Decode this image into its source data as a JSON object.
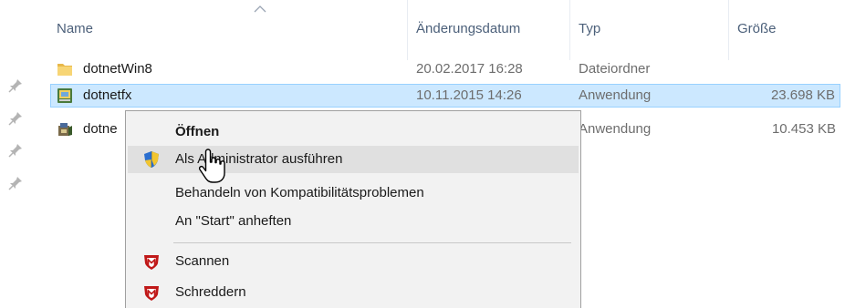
{
  "columns": {
    "name": "Name",
    "date": "Änderungsdatum",
    "type": "Typ",
    "size": "Größe"
  },
  "files": [
    {
      "name": "dotnetWin8",
      "date": "20.02.2017 16:28",
      "type": "Dateiordner",
      "size": "",
      "icon": "folder-icon"
    },
    {
      "name": "dotnetfx",
      "date": "10.11.2015 14:26",
      "type": "Anwendung",
      "size": "23.698 KB",
      "icon": "installer-icon",
      "selected": true
    },
    {
      "name": "dotne",
      "date": "",
      "type": "Anwendung",
      "size": "10.453 KB",
      "icon": "setup-icon"
    }
  ],
  "context_menu": {
    "open": "Öffnen",
    "run_as_admin": "Als Administrator ausführen",
    "troubleshoot_compat": "Behandeln von Kompatibilitätsproblemen",
    "pin_start": "An \"Start\" anheften",
    "scan": "Scannen",
    "shred": "Schreddern",
    "highlighted": "run_as_admin"
  },
  "colors": {
    "selection_bg": "#cce8ff",
    "selection_border": "#99d1ff",
    "menu_bg": "#f2f2f2",
    "menu_highlight": "#e0e0e0",
    "header_text": "#4c607a",
    "mcafee_red": "#c01818"
  }
}
